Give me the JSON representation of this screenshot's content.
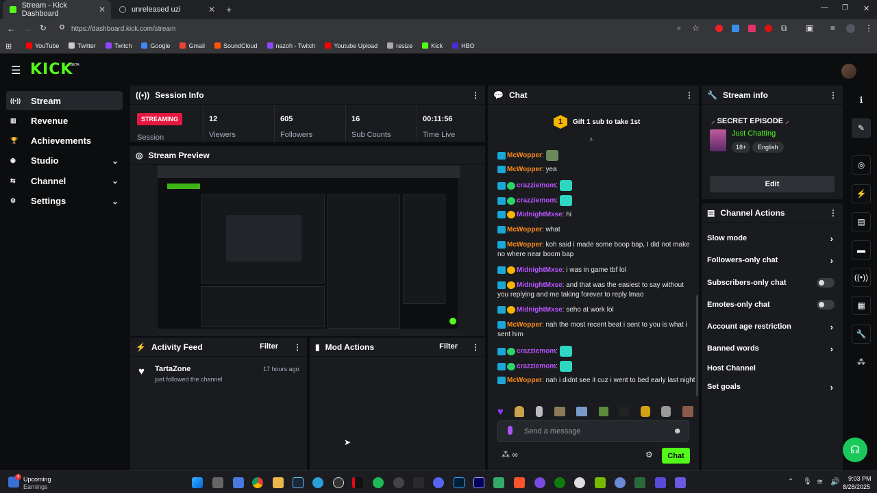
{
  "browser": {
    "tabs": [
      {
        "label": "Stream - Kick Dashboard"
      },
      {
        "label": "unreleased uzi"
      }
    ],
    "url": "https://dashboard.kick.com/stream",
    "bookmarks": [
      {
        "label": "YouTube",
        "color": "#ff0000"
      },
      {
        "label": "Twitter",
        "color": "#cccccc"
      },
      {
        "label": "Twitch",
        "color": "#9146ff"
      },
      {
        "label": "Google",
        "color": "#4285f4"
      },
      {
        "label": "Gmail",
        "color": "#ea4335"
      },
      {
        "label": "SoundCloud",
        "color": "#ff5500"
      },
      {
        "label": "nazoh - Twitch",
        "color": "#9146ff"
      },
      {
        "label": "Youtube Upload",
        "color": "#ff0000"
      },
      {
        "label": "resize",
        "color": "#aaaaaa"
      },
      {
        "label": "Kick",
        "color": "#53fc18"
      },
      {
        "label": "HBO",
        "color": "#4b2cd8"
      }
    ]
  },
  "app": {
    "logo": "KICK",
    "logo_sup": "BETA",
    "accent": "#53fc18"
  },
  "sidebar": {
    "items": [
      {
        "label": "Stream",
        "icon": "broadcast-icon",
        "active": true
      },
      {
        "label": "Revenue",
        "icon": "chart-icon"
      },
      {
        "label": "Achievements",
        "icon": "trophy-icon"
      },
      {
        "label": "Studio",
        "icon": "studio-icon",
        "chevron": true
      },
      {
        "label": "Channel",
        "icon": "channel-icon",
        "chevron": true
      },
      {
        "label": "Settings",
        "icon": "gear-icon",
        "chevron": true
      }
    ]
  },
  "session": {
    "title": "Session Info",
    "status": "STREAMING",
    "status_label": "Session",
    "stats": [
      {
        "value": "12",
        "label": "Viewers"
      },
      {
        "value": "605",
        "label": "Followers"
      },
      {
        "value": "16",
        "label": "Sub Counts"
      },
      {
        "value": "00:11:56",
        "label": "Time Live"
      }
    ]
  },
  "preview": {
    "title": "Stream Preview"
  },
  "activity": {
    "title": "Activity Feed",
    "filter": "Filter",
    "items": [
      {
        "user": "TartaZone",
        "text": "just followed the channel",
        "time": "17 hours ago"
      }
    ]
  },
  "mod": {
    "title": "Mod Actions",
    "filter": "Filter"
  },
  "chat": {
    "title": "Chat",
    "gift": "Gift 1 sub to take 1st",
    "gift_count": "1",
    "messages": [
      {
        "user": "McWopper",
        "color": "#ff8c1a",
        "text": "",
        "emote": true
      },
      {
        "user": "McWopper",
        "color": "#ff8c1a",
        "text": "yea"
      },
      {
        "user": "crazziemom",
        "color": "#b855ff",
        "text": "",
        "emote": true
      },
      {
        "user": "crazziemom",
        "color": "#b855ff",
        "text": "",
        "emote": true
      },
      {
        "user": "MidnightMxse",
        "color": "#b855ff",
        "text": "hi"
      },
      {
        "user": "McWopper",
        "color": "#ff8c1a",
        "text": "what"
      },
      {
        "user": "McWopper",
        "color": "#ff8c1a",
        "text": "koh said i made some boop bap, I did not make no where near boom bap"
      },
      {
        "user": "MidnightMxse",
        "color": "#b855ff",
        "text": "i was in game tbf lol"
      },
      {
        "user": "MidnightMxse",
        "color": "#b855ff",
        "text": "and that was the easiest to say without you replying and me taking forever to reply lmao"
      },
      {
        "user": "MidnightMxse",
        "color": "#b855ff",
        "text": "seho at work lol"
      },
      {
        "user": "McWopper",
        "color": "#ff8c1a",
        "text": "nah the most recent beat i sent to you is what i sent him"
      },
      {
        "user": "crazziemom",
        "color": "#b855ff",
        "text": "",
        "emote": true
      },
      {
        "user": "crazziemom",
        "color": "#b855ff",
        "text": "",
        "emote": true
      },
      {
        "user": "McWopper",
        "color": "#ff8c1a",
        "text": "nah i didnt see it cuz i went to bed early last night"
      }
    ],
    "placeholder": "Send a message",
    "send": "Chat"
  },
  "streaminfo": {
    "title": "Stream info",
    "stream_title": "SECRET EPISODE",
    "category": "Just Chatting",
    "tags": [
      "18+",
      "English"
    ],
    "edit": "Edit"
  },
  "channel_actions": {
    "title": "Channel Actions",
    "items": [
      {
        "label": "Slow mode",
        "type": "arrow"
      },
      {
        "label": "Followers-only chat",
        "type": "arrow"
      },
      {
        "label": "Subscribers-only chat",
        "type": "toggle"
      },
      {
        "label": "Emotes-only chat",
        "type": "toggle"
      },
      {
        "label": "Account age restriction",
        "type": "arrow"
      },
      {
        "label": "Banned words",
        "type": "arrow"
      },
      {
        "label": "Host Channel",
        "type": "none"
      },
      {
        "label": "Set goals",
        "type": "arrow"
      }
    ]
  },
  "taskbar": {
    "weather": "Upcoming",
    "weather_sub": "Earnings",
    "time": "9:03 PM",
    "date": "8/28/2025",
    "notif": "4"
  }
}
